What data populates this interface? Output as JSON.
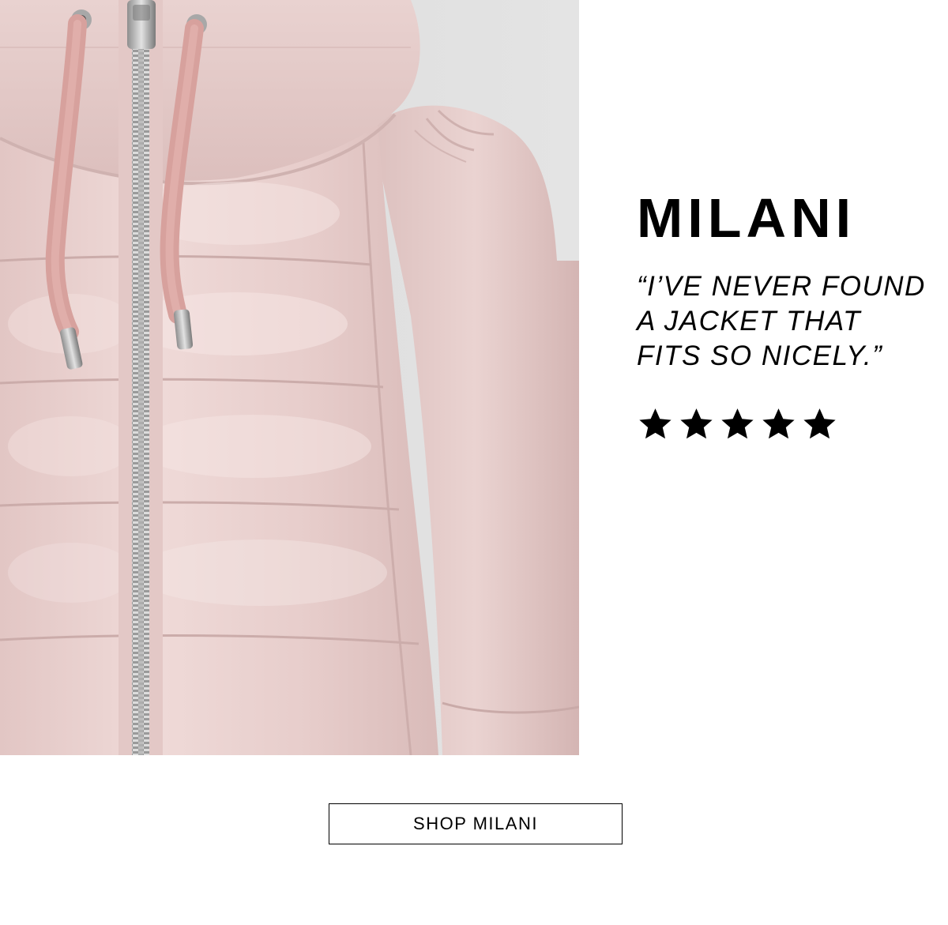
{
  "product": {
    "name": "MILANI",
    "quote_lines": [
      "“I’VE NEVER FOUND",
      "A JACKET THAT",
      "FITS SO NICELY.”"
    ],
    "rating": 5,
    "rating_max": 5,
    "star_icon": "star-icon",
    "star_color": "#000000"
  },
  "cta": {
    "label": "SHOP MILANI"
  },
  "colors": {
    "jacket": "#e8cfcd",
    "drawstring": "#dba8a4",
    "background": "#ffffff"
  }
}
